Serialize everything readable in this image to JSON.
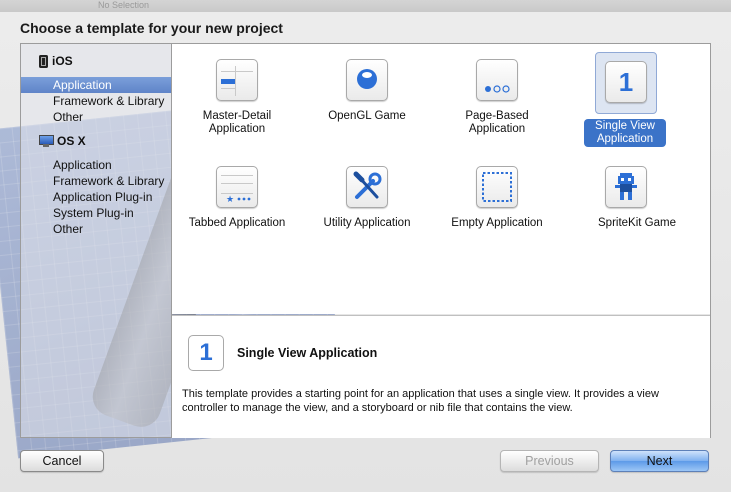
{
  "window": {
    "ghost_title": "No Selection",
    "heading": "Choose a template for your new project"
  },
  "sidebar": {
    "sections": [
      {
        "title": "iOS",
        "icon": "iphone-icon",
        "items": [
          {
            "label": "Application",
            "selected": true
          },
          {
            "label": "Framework & Library",
            "selected": false
          },
          {
            "label": "Other",
            "selected": false
          }
        ]
      },
      {
        "title": "OS X",
        "icon": "mac-icon",
        "items": [
          {
            "label": "Application",
            "selected": false
          },
          {
            "label": "Framework & Library",
            "selected": false
          },
          {
            "label": "Application Plug-in",
            "selected": false
          },
          {
            "label": "System Plug-in",
            "selected": false
          },
          {
            "label": "Other",
            "selected": false
          }
        ]
      }
    ]
  },
  "templates": [
    {
      "label_line1": "Master-Detail",
      "label_line2": "Application",
      "icon": "master-detail-icon",
      "selected": false
    },
    {
      "label_line1": "OpenGL Game",
      "label_line2": "",
      "icon": "opengl-game-icon",
      "selected": false
    },
    {
      "label_line1": "Page-Based",
      "label_line2": "Application",
      "icon": "page-based-icon",
      "selected": false
    },
    {
      "label_line1": "Single View",
      "label_line2": "Application",
      "icon": "single-view-icon",
      "selected": true,
      "glyph": "1"
    },
    {
      "label_line1": "Tabbed Application",
      "label_line2": "",
      "icon": "tabbed-icon",
      "selected": false
    },
    {
      "label_line1": "Utility Application",
      "label_line2": "",
      "icon": "utility-icon",
      "selected": false
    },
    {
      "label_line1": "Empty Application",
      "label_line2": "",
      "icon": "empty-application-icon",
      "selected": false
    },
    {
      "label_line1": "SpriteKit Game",
      "label_line2": "",
      "icon": "spritekit-game-icon",
      "selected": false
    }
  ],
  "detail": {
    "icon_glyph": "1",
    "title": "Single View Application",
    "description": "This template provides a starting point for an application that uses a single view. It provides a view controller to manage the view, and a storyboard or nib file that contains the view."
  },
  "buttons": {
    "cancel": "Cancel",
    "previous": "Previous",
    "next": "Next"
  },
  "colors": {
    "accent": "#3b73c8",
    "selection": "#5f84c8",
    "icon_blue": "#2c6fd6"
  }
}
